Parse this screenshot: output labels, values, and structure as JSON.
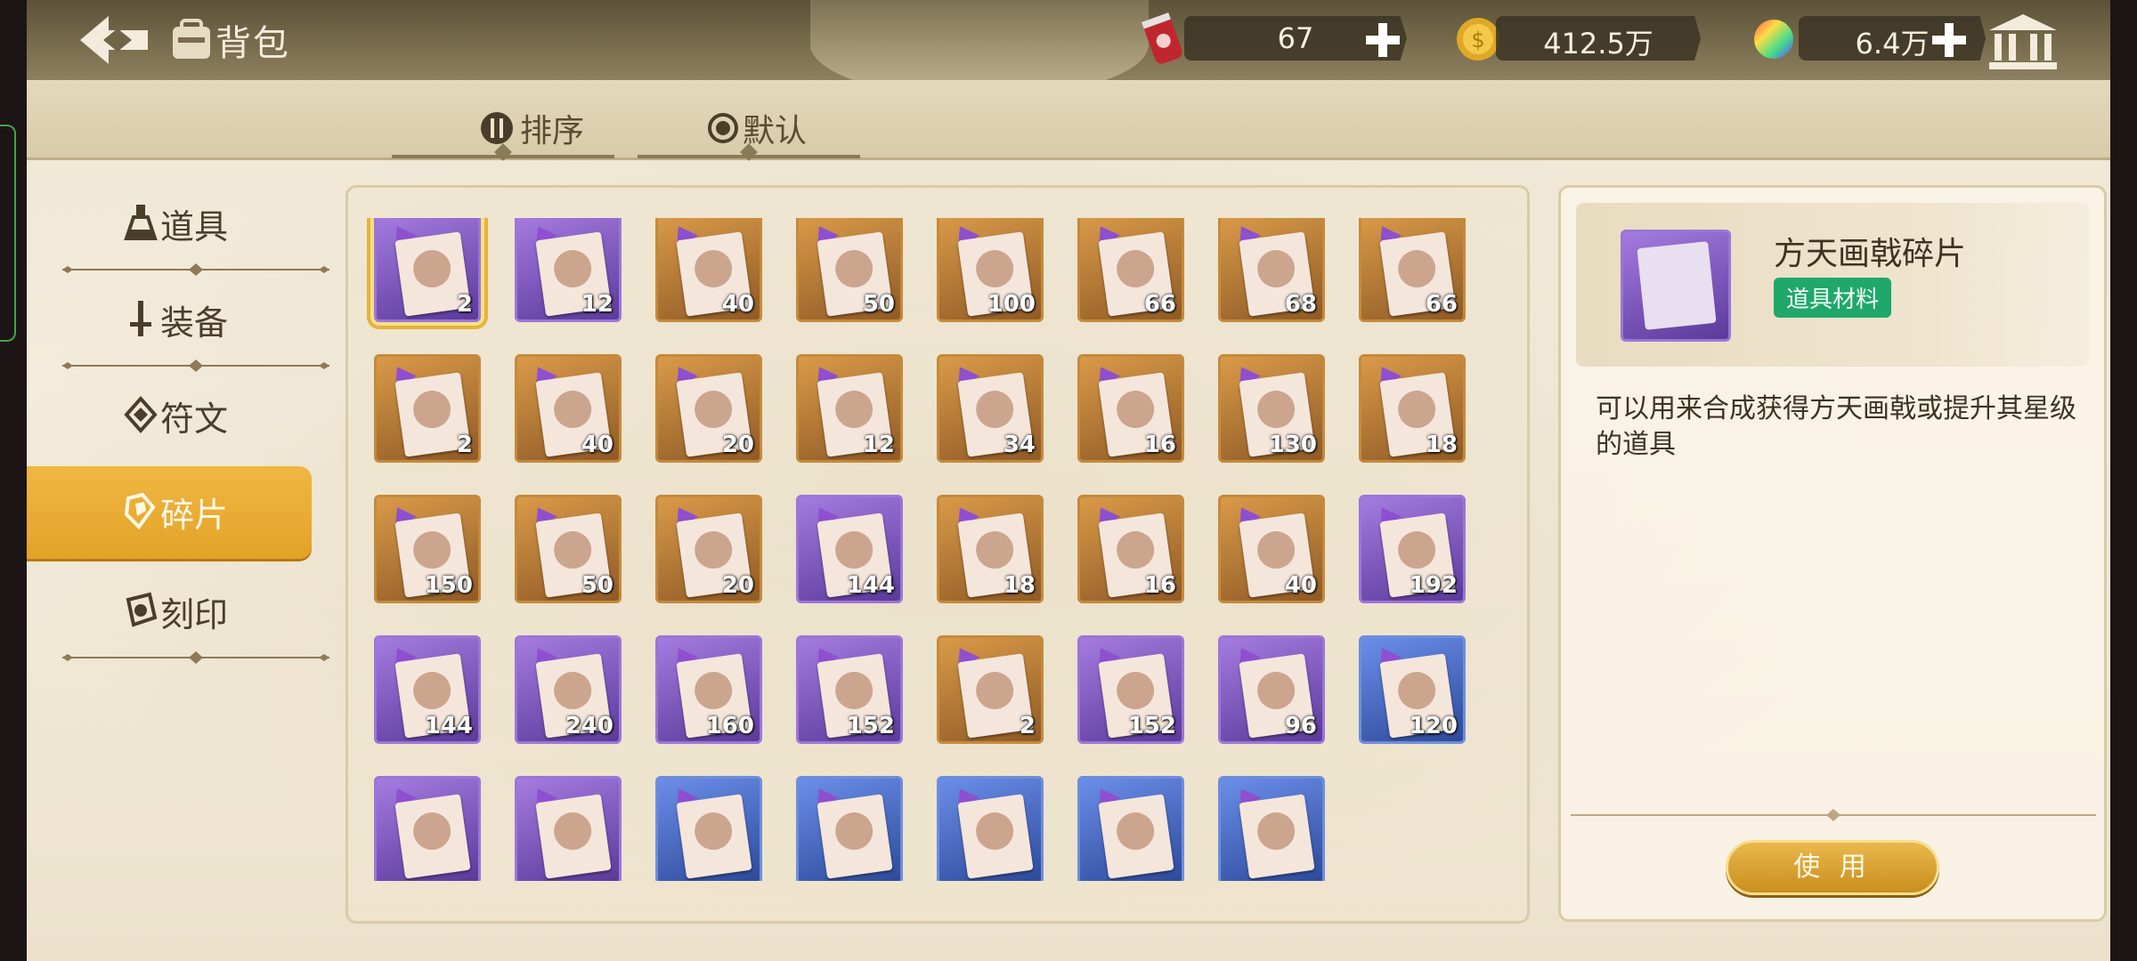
{
  "header": {
    "title": "背包",
    "resources": [
      {
        "name": "energy-can",
        "value": "67",
        "has_plus": true
      },
      {
        "name": "gold-coin",
        "value": "412.5万",
        "has_plus": false
      },
      {
        "name": "rainbow-gem",
        "value": "6.4万",
        "has_plus": true
      }
    ]
  },
  "subtabs": [
    {
      "label": "排序",
      "icon": "sort-icon"
    },
    {
      "label": "默认",
      "icon": "radio-icon"
    }
  ],
  "nav": [
    {
      "label": "道具",
      "icon": "potion-icon",
      "active": false
    },
    {
      "label": "装备",
      "icon": "sword-icon",
      "active": false
    },
    {
      "label": "符文",
      "icon": "rune-icon",
      "active": false
    },
    {
      "label": "碎片",
      "icon": "shard-icon",
      "active": true
    },
    {
      "label": "刻印",
      "icon": "seal-icon",
      "active": false
    }
  ],
  "grid": {
    "rows": [
      [
        {
          "count": "2",
          "frame": "purple",
          "selected": true
        },
        {
          "count": "12",
          "frame": "purple"
        },
        {
          "count": "40",
          "frame": "gold"
        },
        {
          "count": "50",
          "frame": "gold"
        },
        {
          "count": "100",
          "frame": "gold"
        },
        {
          "count": "66",
          "frame": "gold"
        },
        {
          "count": "68",
          "frame": "gold"
        },
        {
          "count": "66",
          "frame": "gold"
        }
      ],
      [
        {
          "count": "2",
          "frame": "gold"
        },
        {
          "count": "40",
          "frame": "gold"
        },
        {
          "count": "20",
          "frame": "gold"
        },
        {
          "count": "12",
          "frame": "gold"
        },
        {
          "count": "34",
          "frame": "gold"
        },
        {
          "count": "16",
          "frame": "gold"
        },
        {
          "count": "130",
          "frame": "gold"
        },
        {
          "count": "18",
          "frame": "gold"
        }
      ],
      [
        {
          "count": "150",
          "frame": "gold"
        },
        {
          "count": "50",
          "frame": "gold"
        },
        {
          "count": "20",
          "frame": "gold"
        },
        {
          "count": "144",
          "frame": "purple"
        },
        {
          "count": "18",
          "frame": "gold"
        },
        {
          "count": "16",
          "frame": "gold"
        },
        {
          "count": "40",
          "frame": "gold"
        },
        {
          "count": "192",
          "frame": "purple"
        }
      ],
      [
        {
          "count": "144",
          "frame": "purple"
        },
        {
          "count": "240",
          "frame": "purple"
        },
        {
          "count": "160",
          "frame": "purple"
        },
        {
          "count": "152",
          "frame": "purple"
        },
        {
          "count": "2",
          "frame": "gold"
        },
        {
          "count": "152",
          "frame": "purple"
        },
        {
          "count": "96",
          "frame": "purple"
        },
        {
          "count": "120",
          "frame": "blue"
        }
      ],
      [
        {
          "count": "",
          "frame": "purple"
        },
        {
          "count": "",
          "frame": "purple"
        },
        {
          "count": "",
          "frame": "blue"
        },
        {
          "count": "",
          "frame": "blue"
        },
        {
          "count": "",
          "frame": "blue"
        },
        {
          "count": "",
          "frame": "blue"
        },
        {
          "count": "",
          "frame": "blue"
        }
      ]
    ]
  },
  "detail": {
    "name": "方天画戟碎片",
    "tag": "道具材料",
    "description": "可以用来合成获得方天画戟或提升其星级的道具",
    "use_label": "使 用"
  },
  "colors": {
    "accent_gold": "#e3a226",
    "tag_green": "#1fa86a",
    "frame_purple": "#9b76d6",
    "frame_gold": "#c48a3c",
    "frame_blue": "#6e8edc"
  }
}
